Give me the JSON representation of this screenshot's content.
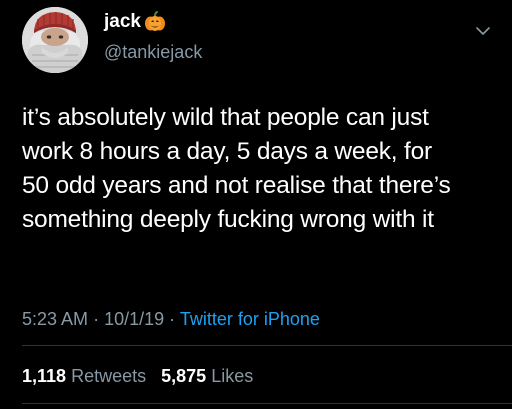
{
  "author": {
    "display_name": "jack",
    "handle": "@tankiejack",
    "name_emoji_icon": "pumpkin-icon"
  },
  "tweet": {
    "text_lines": [
      "it’s absolutely wild that people can just",
      "work 8 hours a day, 5 days a week, for",
      "50 odd years and not realise that there’s",
      "something deeply fucking wrong with it"
    ]
  },
  "meta": {
    "time": "5:23 AM",
    "separator": "·",
    "date": "10/1/19",
    "source": "Twitter for iPhone"
  },
  "stats": {
    "retweets_count": "1,118",
    "retweets_label": "Retweets",
    "likes_count": "5,875",
    "likes_label": "Likes"
  },
  "colors": {
    "background": "#000000",
    "text": "#ffffff",
    "secondary": "#8899a6",
    "link": "#1da1f2"
  }
}
